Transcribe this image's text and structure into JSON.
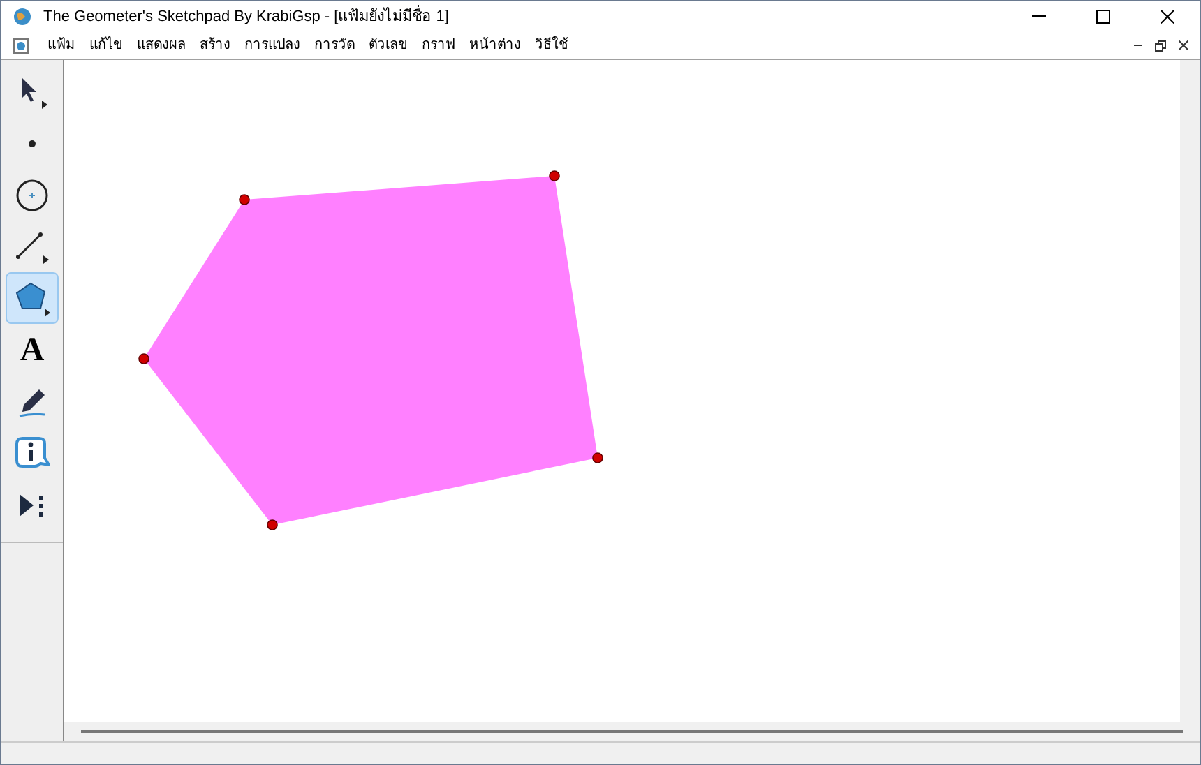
{
  "window": {
    "title": "The Geometer's Sketchpad By KrabiGsp - [แฟ้มยังไม่มีชื่อ 1]"
  },
  "menu": [
    "แฟ้ม",
    "แก้ไข",
    "แสดงผล",
    "สร้าง",
    "การแปลง",
    "การวัด",
    "ตัวเลข",
    "กราฟ",
    "หน้าต่าง",
    "วิธีใช้"
  ],
  "tools": [
    {
      "kind": "arrow",
      "selected": false
    },
    {
      "kind": "point",
      "selected": false
    },
    {
      "kind": "compass",
      "selected": false
    },
    {
      "kind": "line",
      "selected": false
    },
    {
      "kind": "polygon",
      "selected": true
    },
    {
      "kind": "text",
      "selected": false,
      "glyph": "A"
    },
    {
      "kind": "marker",
      "selected": false
    },
    {
      "kind": "info",
      "selected": false
    },
    {
      "kind": "custom",
      "selected": false
    }
  ]
}
